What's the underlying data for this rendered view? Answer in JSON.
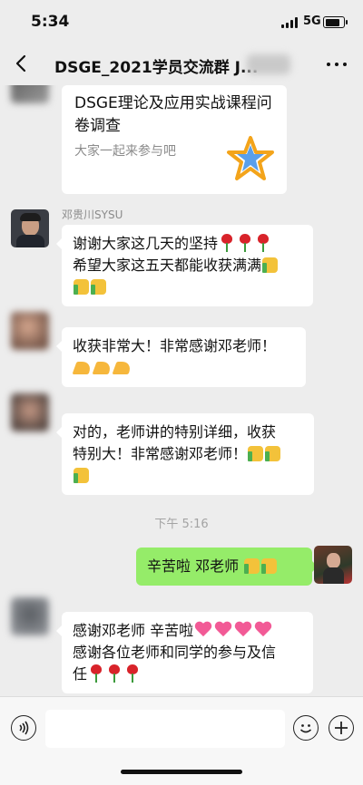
{
  "status_bar": {
    "time": "5:34",
    "network": "5G"
  },
  "header": {
    "title": "DSGE_2021学员交流群 J..."
  },
  "messages": {
    "card": {
      "title": "DSGE理论及应用实战课程问卷调查",
      "desc": "大家一起来参与吧",
      "icon": "star-icon"
    },
    "m1": {
      "sender": "邓贵川SYSU",
      "line1": "谢谢大家这几天的坚持",
      "line2": "希望大家这五天都能收获满满"
    },
    "m2": {
      "line1": "收获非常大！非常感谢邓老师！"
    },
    "m3": {
      "line1": "对的，老师讲的特别详细，收获",
      "line2": "特别大！非常感谢邓老师！"
    },
    "timestamp": "下午 5:16",
    "m4": {
      "text": "辛苦啦 邓老师"
    },
    "m5": {
      "line1": "感谢邓老师 辛苦啦",
      "line2": "感谢各位老师和同学的参与及信",
      "line3": "任"
    }
  },
  "input_bar": {
    "placeholder": ""
  },
  "colors": {
    "background": "#ededed",
    "my_bubble": "#95ec69",
    "other_bubble": "#ffffff"
  }
}
